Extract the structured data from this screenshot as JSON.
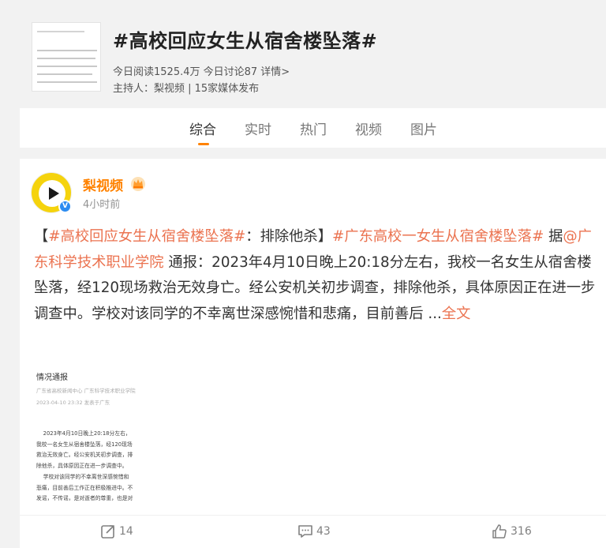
{
  "topic": {
    "title": "#高校回应女生从宿舍楼坠落#",
    "stats": "今日阅读1525.4万 今日讨论87 详情>",
    "host": "主持人：梨视频 | 15家媒体发布",
    "thumbnail_lines": [
      "广东科学技术职业学院",
      "4月10日晚上20:18分左右，",
      "经公安机关初步调查，",
      "后期家人来联系。"
    ]
  },
  "tabs": [
    {
      "label": "综合",
      "active": true
    },
    {
      "label": "实时",
      "active": false
    },
    {
      "label": "热门",
      "active": false
    },
    {
      "label": "视频",
      "active": false
    },
    {
      "label": "图片",
      "active": false
    }
  ],
  "post": {
    "author": "梨视频",
    "time": "4小时前",
    "text": {
      "p1": "【",
      "tag1": "#高校回应女生从宿舍楼坠落#",
      "p2": "：排除他杀】",
      "tag2": "#广东高校一女生从宿舍楼坠落#",
      "p3": " 据",
      "mention": "@广东科学技术职业学院",
      "p4": " 通报：2023年4月10日晚上20:18分左右，我校一名女生从宿舍楼坠落，经120现场救治无效身亡。经公安机关初步调查，排除他杀，具体原因正在进一步调查中。学校对该同学的不幸离世深感惋惜和悲痛，目前善后 ...",
      "more": "全文"
    },
    "image": {
      "title": "情况通报",
      "source": "广东省高校新闻中心  广东科学技术职业学院",
      "date": "2023-04-10 23:32  发表于广东",
      "body": "    2023年4月10日晚上20:18分左右，\n我校一名女生从宿舍楼坠落，经120现场\n救治无效身亡。经公安机关初步调查，排\n除他杀，具体原因正在进一步调查中。\n    学校对该同学的不幸离世深感惋惜和\n悲痛，目前善后工作正在积极推进中。不\n发谣，不传谣，是对逝者的尊重，也是对"
    },
    "actions": {
      "forward": "14",
      "comment": "43",
      "like": "316"
    }
  },
  "colors": {
    "accent": "#ff8200",
    "tag": "#eb7350",
    "verified": "#2d8cf0",
    "avatar_bg": "#f5d30d"
  },
  "icons": [
    "crown-icon",
    "verified-icon",
    "forward-icon",
    "comment-icon",
    "like-icon",
    "play-icon"
  ]
}
